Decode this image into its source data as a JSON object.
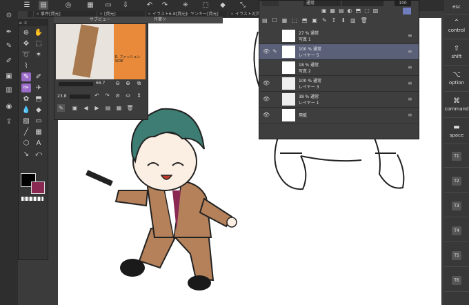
{
  "tabs": [
    "事件[貸元]",
    "[貸元]",
    "イラスト6-8[貸元]",
    "ヤンキー[貸元]",
    "イラスト2[貸元]"
  ],
  "subview": {
    "title": "サブビュー",
    "title2": "作業ツ",
    "zoom": "66.7",
    "angle": "23.8",
    "photo_text": "E. ファッション SIDE"
  },
  "layers": {
    "blend_mode": "通常",
    "opacity_value": "100",
    "rows": [
      {
        "name": "写真 1",
        "opacity": "27 % 通常",
        "selected": false
      },
      {
        "name": "レイヤー 5",
        "opacity": "100 % 通常",
        "selected": true
      },
      {
        "name": "写真 2",
        "opacity": "18 % 通常",
        "selected": false
      },
      {
        "name": "レイヤー 3",
        "opacity": "100 % 通常",
        "selected": false
      },
      {
        "name": "レイヤー 1",
        "opacity": "38 % 通常",
        "selected": false
      },
      {
        "name": "用紙",
        "opacity": "",
        "selected": false
      }
    ]
  },
  "keys": {
    "esc": "esc",
    "control": "control",
    "shift": "shift",
    "option": "option",
    "command": "command",
    "space": "space",
    "t1": "T1",
    "t2": "T2",
    "t3": "T3",
    "t4": "T4",
    "t5": "T5",
    "t6": "T6"
  },
  "colors": {
    "main": "#000000",
    "sub": "#8a2a52",
    "tool_selected": "#9b6cc9",
    "layer_selected": "#5b6079"
  }
}
